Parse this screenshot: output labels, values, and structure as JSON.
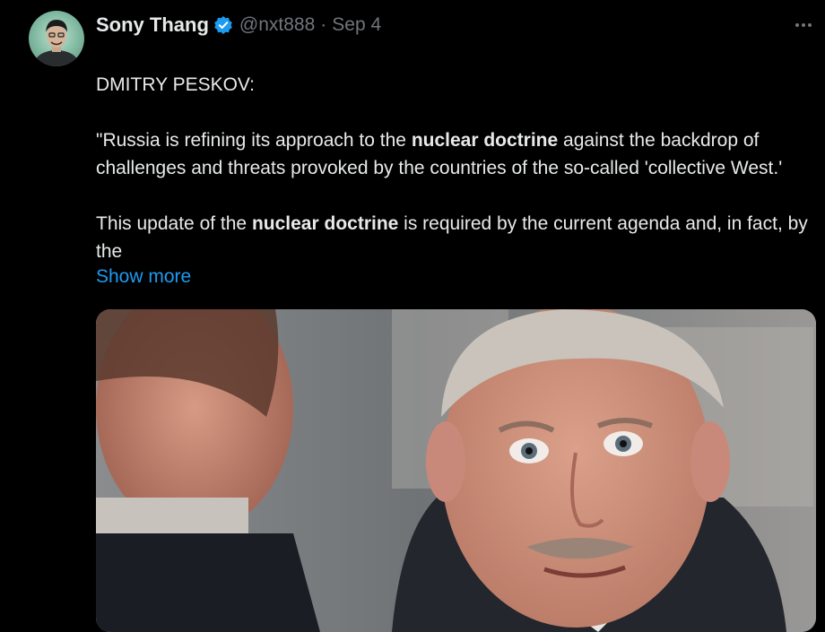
{
  "author": {
    "name": "Sony Thang",
    "handle": "@nxt888",
    "separator": "·",
    "date": "Sep 4",
    "verified": true
  },
  "tweet": {
    "line1": "DMITRY PESKOV:",
    "p1_a": "\"Russia is refining its approach to the ",
    "p1_bold": "nuclear doctrine",
    "p1_b": " against the backdrop of challenges and threats provoked by the countries of the so-called 'collective West.'",
    "p2_a": "This update of the ",
    "p2_bold": "nuclear doctrine",
    "p2_b": " is required by the current agenda and, in fact, by the",
    "show_more": "Show more"
  },
  "colors": {
    "background": "#000000",
    "text": "#e7e9ea",
    "muted": "#71767b",
    "link": "#1d9bf0",
    "verified": "#1d9bf0"
  },
  "icons": [
    "verified-badge-icon",
    "more-options-icon",
    "russia-flag-emoji"
  ]
}
